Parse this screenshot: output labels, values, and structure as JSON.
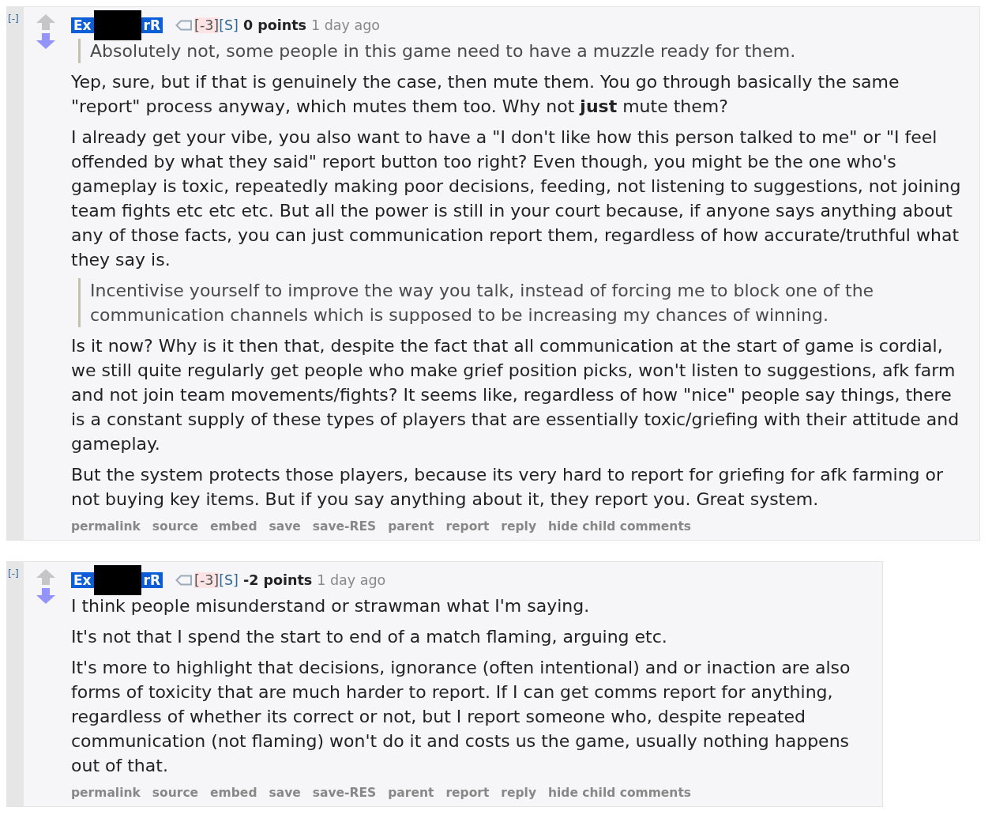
{
  "comments": [
    {
      "collapse": "[-]",
      "user_parts": [
        "Ex",
        "rR"
      ],
      "flair": "[-3]",
      "flair2": "[S]",
      "score": "0 points",
      "time": "1 day ago",
      "blocks": [
        {
          "kind": "quote",
          "text": "Absolutely not, some people in this game need to have a muzzle ready for them."
        },
        {
          "kind": "para",
          "text": "Yep, sure, but if that is genuinely the case, then mute them. You go through basically the same \"report\" process anyway, which mutes them too. Why not **just** mute them?"
        },
        {
          "kind": "para",
          "text": "I already get your vibe, you also want to have a \"I don't like how this person talked to me\" or \"I feel offended by what they said\" report button too right? Even though, you might be the one who's gameplay is toxic, repeatedly making poor decisions, feeding, not listening to suggestions, not joining team fights etc etc etc. But all the power is still in your court because, if anyone says anything about any of those facts, you can just communication report them, regardless of how accurate/truthful what they say is."
        },
        {
          "kind": "quote",
          "text": "Incentivise yourself to improve the way you talk, instead of forcing me to block one of the communication channels which is supposed to be increasing my chances of winning."
        },
        {
          "kind": "para",
          "text": "Is it now? Why is it then that, despite the fact that all communication at the start of game is cordial, we still quite regularly get people who make grief position picks, won't listen to suggestions, afk farm and not join team movements/fights? It seems like, regardless of how \"nice\" people say things, there is a constant supply of these types of players that are essentially toxic/griefing with their attitude and gameplay."
        },
        {
          "kind": "para",
          "text": "But the system protects those players, because its very hard to report for griefing for afk farming or not buying key items. But if you say anything about it, they report you. Great system."
        }
      ],
      "links": [
        "permalink",
        "source",
        "embed",
        "save",
        "save-RES",
        "parent",
        "report",
        "reply",
        "hide child comments"
      ]
    },
    {
      "collapse": "[-]",
      "user_parts": [
        "Ex",
        "rR"
      ],
      "flair": "[-3]",
      "flair2": "[S]",
      "score": "-2 points",
      "time": "1 day ago",
      "blocks": [
        {
          "kind": "para",
          "text": "I think people misunderstand or strawman what I'm saying."
        },
        {
          "kind": "para",
          "text": "It's not that I spend the start to end of a match flaming, arguing etc."
        },
        {
          "kind": "para",
          "text": "It's more to highlight that decisions, ignorance (often intentional) and or inaction are also forms of toxicity that are much harder to report. If I can get comms report for anything, regardless of whether its correct or not, but I report someone who, despite repeated communication (not flaming) won't do it and costs us the game, usually nothing happens out of that."
        }
      ],
      "links": [
        "permalink",
        "source",
        "embed",
        "save",
        "save-RES",
        "parent",
        "report",
        "reply",
        "hide child comments"
      ]
    }
  ]
}
